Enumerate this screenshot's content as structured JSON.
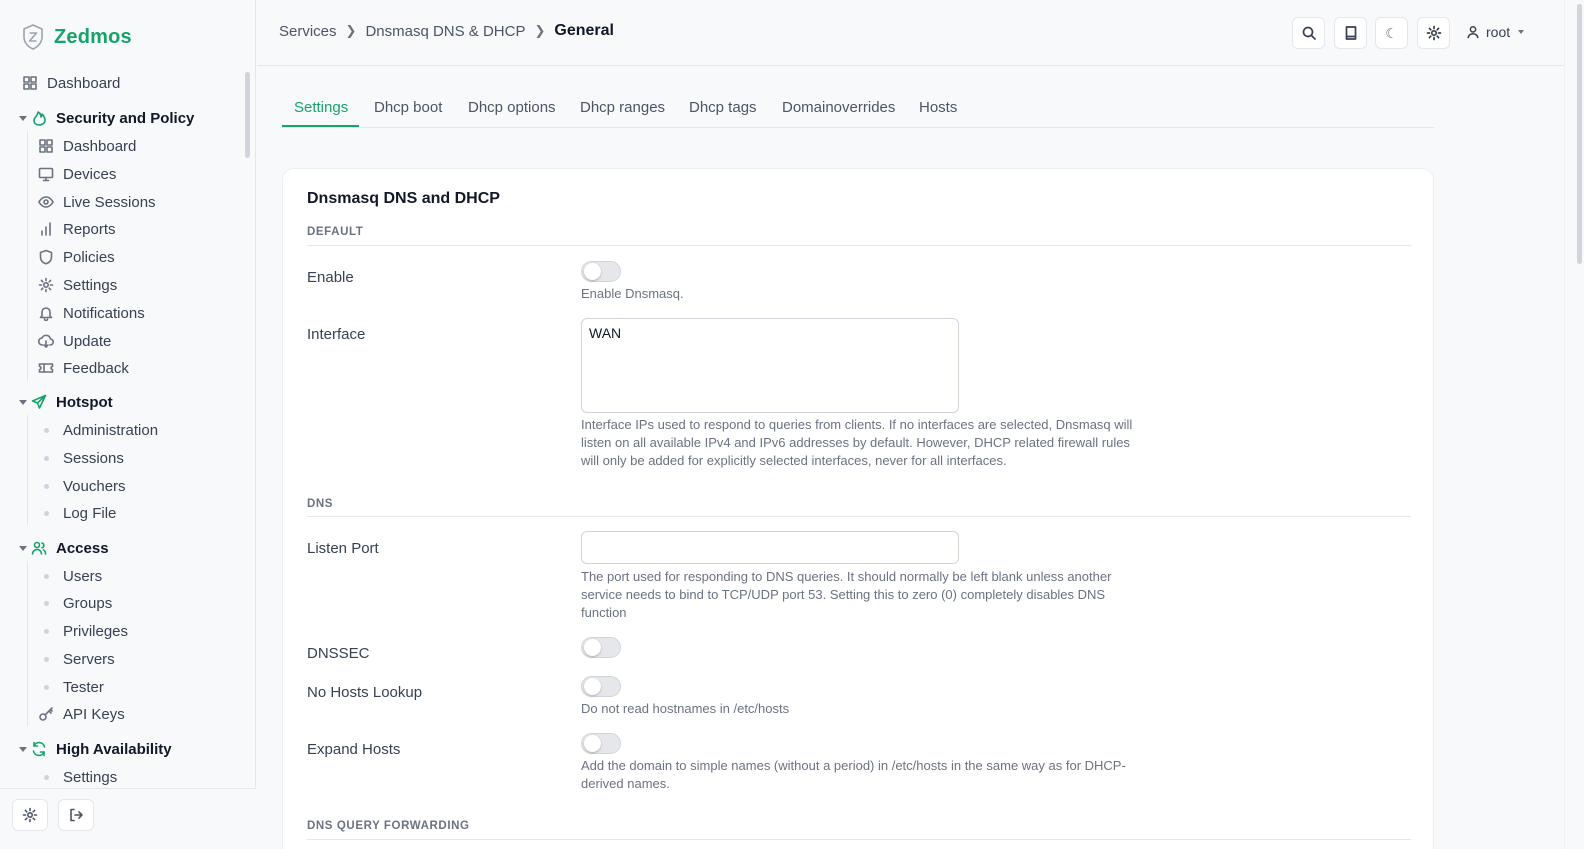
{
  "brand": {
    "name": "Zedmos",
    "accent": "#16a36a"
  },
  "sidebar": {
    "top": {
      "label": "Dashboard",
      "icon": "grid-icon"
    },
    "sections": [
      {
        "title": "Security and Policy",
        "icon": "flame-icon",
        "items": [
          {
            "label": "Dashboard",
            "icon": "grid-icon"
          },
          {
            "label": "Devices",
            "icon": "monitor-icon"
          },
          {
            "label": "Live Sessions",
            "icon": "eye-icon"
          },
          {
            "label": "Reports",
            "icon": "bar-chart-icon"
          },
          {
            "label": "Policies",
            "icon": "shield-icon"
          },
          {
            "label": "Settings",
            "icon": "gear-icon"
          },
          {
            "label": "Notifications",
            "icon": "bell-icon"
          },
          {
            "label": "Update",
            "icon": "cloud-download-icon"
          },
          {
            "label": "Feedback",
            "icon": "ticket-icon"
          }
        ]
      },
      {
        "title": "Hotspot",
        "icon": "send-icon",
        "items": [
          {
            "label": "Administration"
          },
          {
            "label": "Sessions"
          },
          {
            "label": "Vouchers"
          },
          {
            "label": "Log File"
          }
        ]
      },
      {
        "title": "Access",
        "icon": "users-icon",
        "items": [
          {
            "label": "Users"
          },
          {
            "label": "Groups"
          },
          {
            "label": "Privileges"
          },
          {
            "label": "Servers"
          },
          {
            "label": "Tester"
          },
          {
            "label": "API Keys",
            "icon": "key-icon"
          }
        ]
      },
      {
        "title": "High Availability",
        "icon": "refresh-icon",
        "items": [
          {
            "label": "Settings"
          }
        ]
      }
    ]
  },
  "header": {
    "breadcrumb": [
      "Services",
      "Dnsmasq DNS & DHCP",
      "General"
    ],
    "user": "root"
  },
  "tabs": [
    "Settings",
    "Dhcp boot",
    "Dhcp options",
    "Dhcp ranges",
    "Dhcp tags",
    "Domainoverrides",
    "Hosts"
  ],
  "card": {
    "title": "Dnsmasq DNS and DHCP",
    "sections": {
      "default": "DEFAULT",
      "dns": "DNS",
      "forwarding": "DNS QUERY FORWARDING"
    },
    "fields": {
      "enable": {
        "label": "Enable",
        "help": "Enable Dnsmasq.",
        "checked": false
      },
      "interface": {
        "label": "Interface",
        "value": "WAN",
        "help": "Interface IPs used to respond to queries from clients. If no interfaces are selected, Dnsmasq will listen on all available IPv4 and IPv6 addresses by default. However, DHCP related firewall rules will only be added for explicitly selected interfaces, never for all interfaces."
      },
      "listen_port": {
        "label": "Listen Port",
        "value": "",
        "help": "The port used for responding to DNS queries. It should normally be left blank unless another service needs to bind to TCP/UDP port 53. Setting this to zero (0) completely disables DNS function"
      },
      "dnssec": {
        "label": "DNSSEC",
        "checked": false
      },
      "no_hosts": {
        "label": "No Hosts Lookup",
        "help": "Do not read hostnames in /etc/hosts",
        "checked": false
      },
      "expand_hosts": {
        "label": "Expand Hosts",
        "help": "Add the domain to simple names (without a period) in /etc/hosts in the same way as for DHCP-derived names.",
        "checked": false
      }
    }
  }
}
